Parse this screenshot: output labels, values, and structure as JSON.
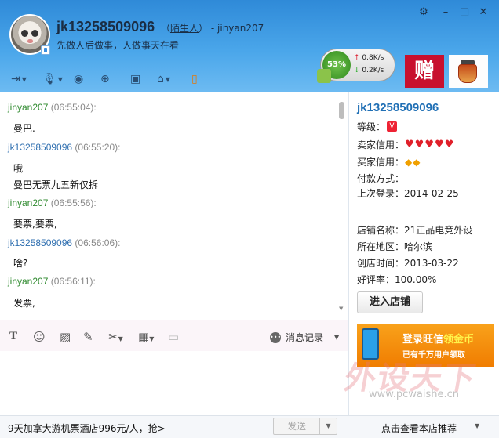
{
  "header": {
    "username": "jk13258509096",
    "relation_open": "（",
    "relation_stranger": "陌生人",
    "relation_close": "）",
    "relation_suffix": "- jinyan207",
    "signature": "先做人后做事，人做事天在看",
    "window_controls": [
      "settings-icon",
      "minimize-icon",
      "maximize-icon",
      "close-icon"
    ],
    "toolbar_icons": [
      "transfer-file-icon",
      "voice-icon",
      "video-icon",
      "add-contact-icon",
      "screen-share-icon",
      "remote-assist-icon",
      "mobile-icon"
    ],
    "net": {
      "percent": "53%",
      "up": "0.8K/s",
      "down": "0.2K/s"
    },
    "ad_zeng": "赠"
  },
  "chat": {
    "messages": [
      {
        "sender": "jinyan207",
        "time": "(06:55:04):",
        "lines": [
          "曼巴."
        ]
      },
      {
        "sender": "jk13258509096",
        "time": "(06:55:20):",
        "lines": [
          "哦",
          "曼巴无票九五新仅拆"
        ]
      },
      {
        "sender": "jinyan207",
        "time": "(06:55:56):",
        "lines": [
          "要票,要票,"
        ]
      },
      {
        "sender": "jk13258509096",
        "time": "(06:56:06):",
        "lines": [
          "啥?"
        ]
      },
      {
        "sender": "jinyan207",
        "time": "(06:56:11):",
        "lines": [
          "发票,"
        ]
      }
    ]
  },
  "input_toolbar": {
    "history_label": "消息记录"
  },
  "bottom": {
    "promo": "9天加拿大游机票酒店996元/人，抢>",
    "send_label": "发送",
    "store_recommend": "点击查看本店推荐"
  },
  "panel": {
    "title": "jk13258509096",
    "level_label": "等级：",
    "level_badge": "V",
    "seller_credit_label": "卖家信用：",
    "seller_hearts": 5,
    "buyer_credit_label": "买家信用：",
    "buyer_diamonds": 2,
    "payment_label": "付款方式：",
    "last_login": "上次登录：2014-02-25",
    "shop_name": "店铺名称：21正品电竞外设",
    "location": "所在地区：哈尔滨",
    "created": "创店时间：2013-03-22",
    "rating": "好评率：100.00%",
    "shop_button": "进入店铺",
    "coin_ad_main_a": "登录旺信",
    "coin_ad_main_b": "领金币",
    "coin_ad_sub": "已有千万用户领取"
  },
  "watermark": {
    "text": "外设天下",
    "url": "www.pcwaishe.cn"
  },
  "colors": {
    "header": "#3d9be4",
    "green_name": "#2f8a2f",
    "blue_name": "#2f6fb0",
    "title_blue": "#1f6fb5"
  }
}
